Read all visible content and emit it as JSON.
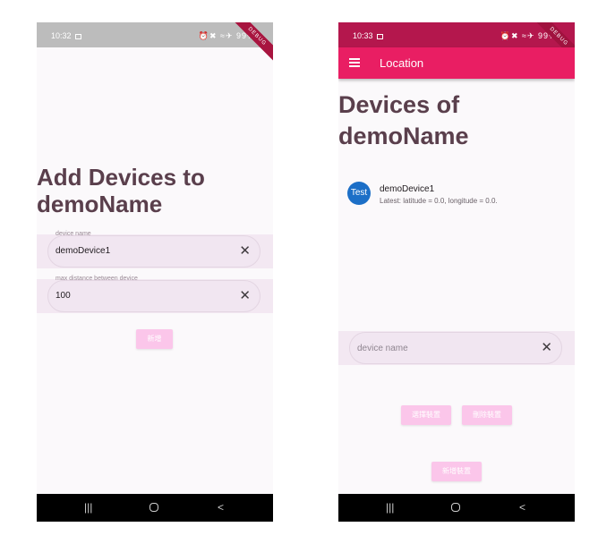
{
  "left_screen": {
    "status": {
      "time": "10:32",
      "icons": "⏰✖ ≈✈ 99%▮"
    },
    "debug_label": "DEBUG",
    "title": "Add Devices to demoName",
    "title_line1": "Add Devices to",
    "title_line2": "demoName",
    "device_name_field": {
      "label": "device name",
      "value": "demoDevice1"
    },
    "distance_field": {
      "label": "max distance between device",
      "value": "100"
    },
    "add_button": "新增",
    "nav": {
      "recents": "|||",
      "back": "<"
    }
  },
  "right_screen": {
    "status": {
      "time": "10:33",
      "icons": "⏰✖ ≈✈ 99%▮"
    },
    "debug_label": "DEBUG",
    "appbar_title": "Location",
    "title_line1": "Devices of",
    "title_line2": "demoName",
    "devices": [
      {
        "avatar": "Test",
        "name": "demoDevice1",
        "latest": "Latest: latitude = 0.0, longitude = 0.0."
      }
    ],
    "device_name_field": {
      "placeholder": "device name"
    },
    "select_button": "選擇裝置",
    "delete_button": "刪除裝置",
    "add_device_button": "新增裝置",
    "nav": {
      "recents": "|||",
      "back": "<"
    }
  },
  "colors": {
    "primary": "#e91e63",
    "statusbar_right": "#b4174d",
    "button": "#fbc6ea",
    "title": "#5a3f4c"
  }
}
